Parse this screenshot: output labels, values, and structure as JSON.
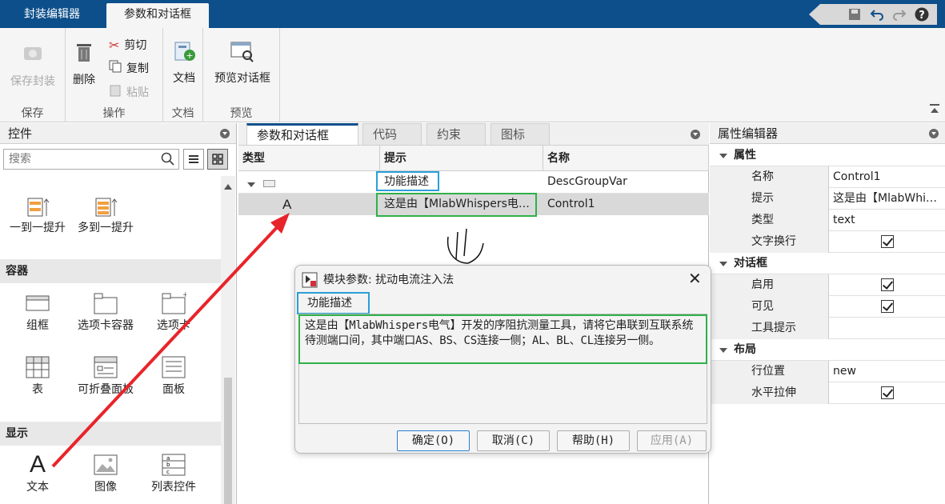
{
  "tabs": {
    "mask_editor": "封装编辑器",
    "params_dialog": "参数和对话框"
  },
  "ribbon": {
    "save_mask": "保存封装",
    "save_group": "保存",
    "delete": "删除",
    "cut": "剪切",
    "copy": "复制",
    "paste": "粘贴",
    "ops_group": "操作",
    "doc": "文档",
    "doc_group": "文档",
    "preview": "预览对话框",
    "preview_group": "预览"
  },
  "left_panel": {
    "title": "控件",
    "search_placeholder": "搜索",
    "items_top": [
      "一到一提升",
      "多到一提升"
    ],
    "section_container": "容器",
    "container_items": [
      "组框",
      "选项卡容器",
      "选项卡",
      "表",
      "可折叠面板",
      "面板"
    ],
    "section_display": "显示",
    "display_items": [
      "文本",
      "图像",
      "列表控件"
    ]
  },
  "center": {
    "tabs": [
      "参数和对话框",
      "代码",
      "约束",
      "图标"
    ],
    "columns": [
      "类型",
      "提示",
      "名称"
    ],
    "rows": [
      {
        "type": "",
        "prompt": "功能描述",
        "name": "DescGroupVar"
      },
      {
        "type": "A",
        "prompt": "这是由【MlabWhispers电…",
        "name": "Control1"
      }
    ]
  },
  "props": {
    "title": "属性编辑器",
    "groups": [
      {
        "label": "属性",
        "rows": [
          {
            "name": "名称",
            "value": "Control1"
          },
          {
            "name": "提示",
            "value": "这是由【MlabWhi…"
          },
          {
            "name": "类型",
            "value": "text"
          },
          {
            "name": "文字换行",
            "value": ""
          }
        ]
      },
      {
        "label": "对话框",
        "rows": [
          {
            "name": "启用",
            "value": ""
          },
          {
            "name": "可见",
            "value": ""
          },
          {
            "name": "工具提示",
            "value": ""
          }
        ]
      },
      {
        "label": "布局",
        "rows": [
          {
            "name": "行位置",
            "value": "new"
          },
          {
            "name": "水平拉伸",
            "value": ""
          }
        ]
      }
    ]
  },
  "dialog": {
    "title": "模块参数: 扰动电流注入法",
    "group_label": "功能描述",
    "text": "这是由【MlabWhispers电气】开发的序阻抗测量工具，请将它串联到互联系统待测端口间，其中端口AS、BS、CS连接一侧；AL、BL、CL连接另一侧。",
    "ok": "确定(O)",
    "cancel": "取消(C)",
    "help": "帮助(H)",
    "apply": "应用(A)"
  },
  "colors": {
    "accent": "#0d4f8a",
    "arrow": "#e8242b",
    "highlight_blue": "#2a9fd6",
    "highlight_green": "#2fb04a"
  }
}
